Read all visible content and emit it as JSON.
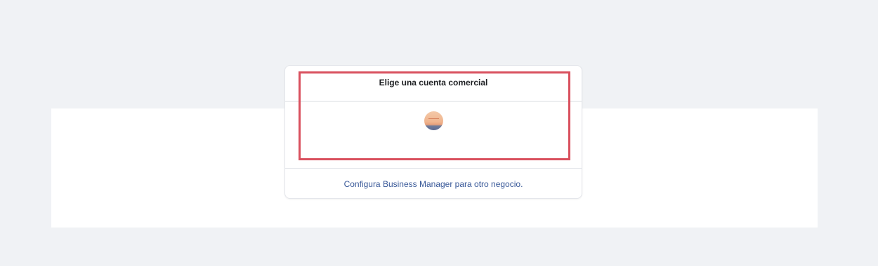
{
  "business_picker": {
    "title": "Elige una cuenta comercial",
    "accounts": [
      {
        "avatar_icon": "business-account-avatar"
      }
    ],
    "setup_link": "Configura Business Manager para otro negocio."
  },
  "colors": {
    "page_background": "#f0f2f5",
    "link": "#385898",
    "highlight": "#d9505e"
  }
}
